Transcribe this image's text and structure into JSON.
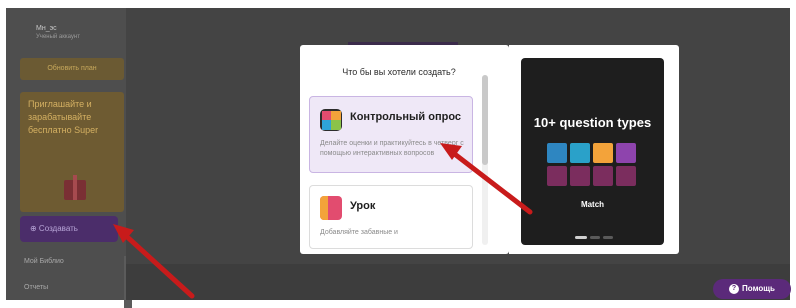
{
  "sidebar": {
    "user_name": "Мн_эс",
    "user_sub": "Ученый аккаунт",
    "upgrade_label": "Обновить план",
    "promo_text": "Приглашайте и зарабатывайте бесплатно Super",
    "create_label": "⊕ Создавать",
    "nav_item_1": "Мой Библио",
    "nav_item_2": "Отчеты"
  },
  "modal": {
    "title": "Что бы вы хотели создать?",
    "cards": [
      {
        "title": "Контрольный опрос",
        "description": "Делайте оценки и практикуйтесь в четверг с помощью интерактивных вопросов"
      },
      {
        "title": "Урок",
        "description": "Добавляйте забавные и"
      }
    ]
  },
  "preview": {
    "headline": "10+ question types",
    "tiles_row1": [
      "",
      "",
      "",
      ""
    ],
    "tiles_row2": [
      "",
      "",
      "",
      ""
    ],
    "subtitle": "Match"
  },
  "help": {
    "label": "Помощь"
  },
  "colors": {
    "accent_purple": "#5b2a7a",
    "arrow_red": "#c81b1b"
  }
}
